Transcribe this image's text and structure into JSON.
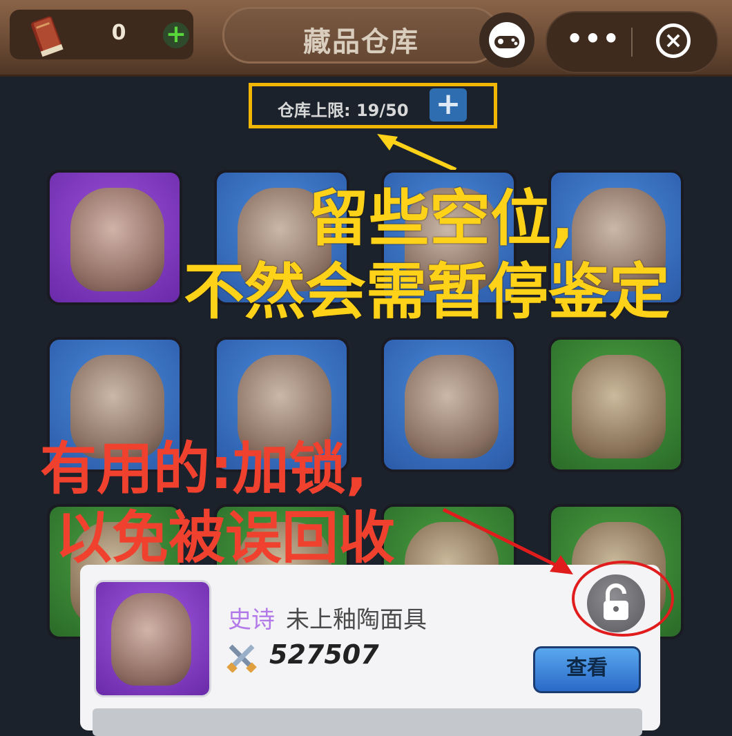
{
  "header": {
    "coin_value": "0",
    "coin_plus": "+",
    "title": "藏品仓库",
    "more_label": "•••",
    "close_label": "×"
  },
  "capacity": {
    "label": "仓库上限: 19/50",
    "used": 19,
    "max": 50,
    "plus": "+"
  },
  "grid": {
    "tiles": [
      {
        "rarity": "purple"
      },
      {
        "rarity": "blue"
      },
      {
        "rarity": "blue"
      },
      {
        "rarity": "blue"
      },
      {
        "rarity": "blue"
      },
      {
        "rarity": "blue"
      },
      {
        "rarity": "blue"
      },
      {
        "rarity": "green"
      },
      {
        "rarity": "green"
      },
      {
        "rarity": "green"
      },
      {
        "rarity": "green"
      },
      {
        "rarity": "green"
      }
    ]
  },
  "annotations": {
    "yellow_line1": "留些空位,",
    "yellow_line2": "不然会需暂停鉴定",
    "red_line1": "有用的:加锁,",
    "red_line2": "以免被误回收"
  },
  "detail_card": {
    "rarity": "史诗",
    "name": "未上釉陶面具",
    "power": "527507",
    "view_label": "查看",
    "lock_state": "unlocked",
    "lock_icon": "unlock-icon"
  },
  "colors": {
    "annotation_yellow": "#ffd21a",
    "annotation_red": "#f0402e",
    "highlight_box": "#f2b705",
    "rarity_epic": "#b27ae8"
  }
}
